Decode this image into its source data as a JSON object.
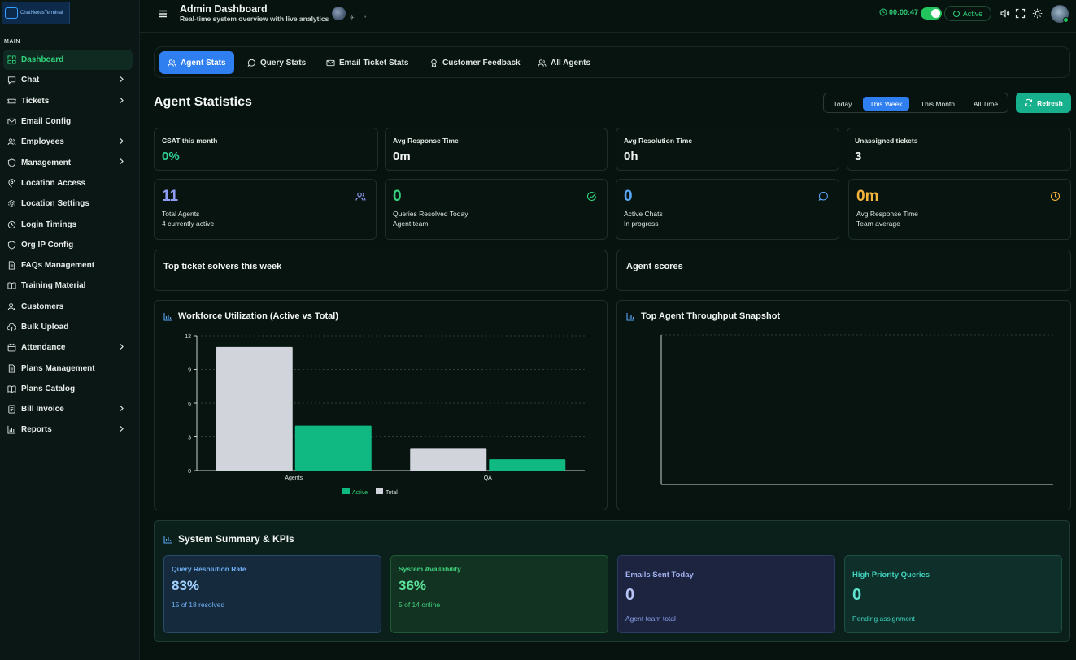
{
  "app": {
    "logo_text": "ChatNexusTerminal"
  },
  "sidebar": {
    "section_label": "MAIN",
    "items": [
      {
        "label": "Dashboard",
        "icon": "grid-icon",
        "active": true,
        "chevron": false
      },
      {
        "label": "Chat",
        "icon": "chat-icon",
        "chevron": true
      },
      {
        "label": "Tickets",
        "icon": "ticket-icon",
        "chevron": true
      },
      {
        "label": "Email Config",
        "icon": "mail-icon",
        "chevron": false
      },
      {
        "label": "Employees",
        "icon": "users-icon",
        "chevron": true
      },
      {
        "label": "Management",
        "icon": "shield-icon",
        "chevron": true
      },
      {
        "label": "Location Access",
        "icon": "location-icon",
        "chevron": false
      },
      {
        "label": "Location Settings",
        "icon": "gear-icon",
        "chevron": false
      },
      {
        "label": "Login Timings",
        "icon": "clock-icon",
        "chevron": false
      },
      {
        "label": "Org IP Config",
        "icon": "shield-icon",
        "chevron": false
      },
      {
        "label": "FAQs Management",
        "icon": "document-icon",
        "chevron": false
      },
      {
        "label": "Training Material",
        "icon": "book-icon",
        "chevron": false
      },
      {
        "label": "Customers",
        "icon": "user-icon",
        "chevron": false
      },
      {
        "label": "Bulk Upload",
        "icon": "upload-icon",
        "chevron": false
      },
      {
        "label": "Attendance",
        "icon": "calendar-icon",
        "chevron": true
      },
      {
        "label": "Plans Management",
        "icon": "document-icon",
        "chevron": false
      },
      {
        "label": "Plans Catalog",
        "icon": "book-icon",
        "chevron": false
      },
      {
        "label": "Bill Invoice",
        "icon": "invoice-icon",
        "chevron": true
      },
      {
        "label": "Reports",
        "icon": "bar-chart-icon",
        "chevron": true
      }
    ]
  },
  "header": {
    "title": "Admin Dashboard",
    "subtitle": "Real-time system overview with live analytics",
    "timer": "00:00:47",
    "status": "Active"
  },
  "tabs": [
    {
      "label": "Agent Stats",
      "icon": "users-icon",
      "active": true
    },
    {
      "label": "Query Stats",
      "icon": "chat-icon"
    },
    {
      "label": "Email Ticket Stats",
      "icon": "mail-icon"
    },
    {
      "label": "Customer Feedback",
      "icon": "award-icon"
    },
    {
      "label": "All Agents",
      "icon": "users-icon"
    }
  ],
  "main": {
    "title": "Agent Statistics",
    "ranges": [
      "Today",
      "This Week",
      "This Month",
      "All Time"
    ],
    "selected_range": "This Week",
    "refresh_label": "Refresh"
  },
  "stats": [
    {
      "label": "CSAT this month",
      "value": "0%",
      "color": "#2fd39a"
    },
    {
      "label": "Avg Response Time",
      "value": "0m",
      "color": "#f1f5f3"
    },
    {
      "label": "Avg Resolution Time",
      "value": "0h",
      "color": "#f1f5f3"
    },
    {
      "label": "Unassigned tickets",
      "value": "3",
      "color": "#f1f5f3"
    }
  ],
  "metrics": [
    {
      "value": "11",
      "line1": "Total Agents",
      "line2": "4 currently active",
      "color": "#8f9cf5",
      "icon": "users-icon"
    },
    {
      "value": "0",
      "line1": "Queries Resolved Today",
      "line2": "Agent team",
      "color": "#34d27e",
      "icon": "check-circle-icon"
    },
    {
      "value": "0",
      "line1": "Active Chats",
      "line2": "In progress",
      "color": "#58a6f5",
      "icon": "chat-icon"
    },
    {
      "value": "0m",
      "line1": "Avg Response Time",
      "line2": "Team average",
      "color": "#f5b43a",
      "icon": "clock-icon"
    }
  ],
  "panels": {
    "top_solvers": "Top ticket solvers this week",
    "agent_scores": "Agent scores",
    "workforce_title": "Workforce Utilization (Active vs Total)",
    "throughput_title": "Top Agent Throughput Snapshot"
  },
  "chart_data": {
    "type": "bar",
    "categories": [
      "Agents",
      "QA"
    ],
    "series": [
      {
        "name": "Total",
        "values": [
          11,
          2
        ],
        "color": "#d1d5db"
      },
      {
        "name": "Active",
        "values": [
          4,
          1
        ],
        "color": "#10b981"
      }
    ],
    "yticks": [
      "0",
      "3",
      "6",
      "9",
      "12"
    ],
    "ylim": [
      0,
      12
    ],
    "legend_position": "bottom",
    "legend": [
      "Active",
      "Total"
    ],
    "grid": true
  },
  "summary": {
    "title": "System Summary & KPIs",
    "kpis": [
      {
        "label": "Query Resolution Rate",
        "value": "83%",
        "sub": "15 of 18 resolved",
        "bg": "#152a3d",
        "border": "#2a4a6a",
        "label_color": "#6fb0f5",
        "value_color": "#9fd0ff",
        "sub_color": "#6fb0f5"
      },
      {
        "label": "System Availability",
        "value": "36%",
        "sub": "5 of 14 online",
        "bg": "#123322",
        "border": "#1f5a35",
        "label_color": "#40d07d",
        "value_color": "#5ce59a",
        "sub_color": "#40d07d"
      },
      {
        "label": "Emails Sent Today",
        "value": "0",
        "sub": "Agent team total",
        "bg": "#1c2440",
        "border": "#2e3b66",
        "label_color": "#a3b3f0",
        "value_color": "#b8c4f5",
        "sub_color": "#8da0ea"
      },
      {
        "label": "High Priority Queries",
        "value": "0",
        "sub": "Pending assignment",
        "bg": "#0f2f2a",
        "border": "#1f4e45",
        "label_color": "#3fd3bd",
        "value_color": "#5fe3cf",
        "sub_color": "#3fd3bd"
      }
    ]
  }
}
